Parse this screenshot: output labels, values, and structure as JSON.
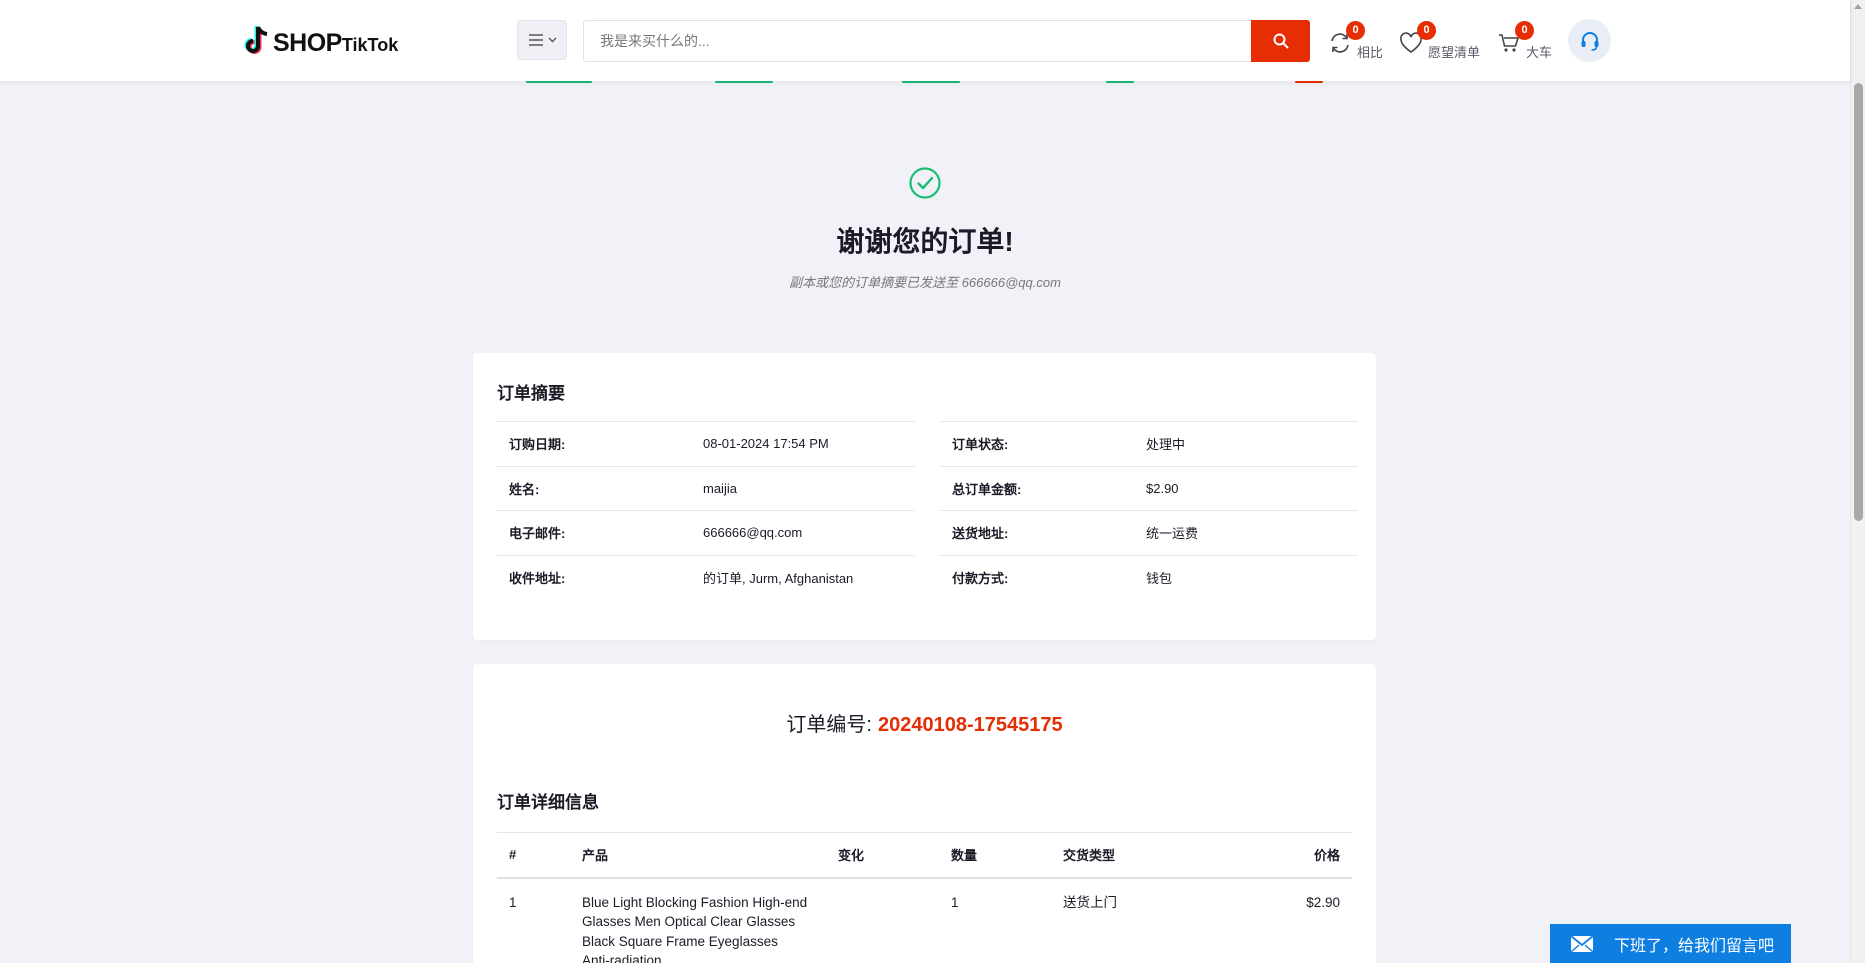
{
  "header": {
    "logo": {
      "shop": "SHOP",
      "tiktok": "TikTok"
    },
    "search": {
      "placeholder": "我是来买什么的..."
    },
    "compare": {
      "label": "相比",
      "count": "0"
    },
    "wishlist": {
      "label": "愿望清单",
      "count": "0"
    },
    "cart": {
      "label": "大车",
      "count": "0"
    },
    "icons": [
      "menu-icon",
      "chevron-down-icon",
      "search-icon",
      "refresh-icon",
      "heart-icon",
      "cart-icon",
      "headset-icon"
    ]
  },
  "colors": {
    "accent": "#e62d04",
    "success": "#1abc74",
    "chat": "#0e7fe1"
  },
  "hero": {
    "title": "谢谢您的订单!",
    "subtitle": "副本或您的订单摘要已发送至 666666@qq.com"
  },
  "summary": {
    "title": "订单摘要",
    "left": [
      {
        "k": "订购日期:",
        "v": "08-01-2024 17:54 PM"
      },
      {
        "k": "姓名:",
        "v": "maijia"
      },
      {
        "k": "电子邮件:",
        "v": "666666@qq.com"
      },
      {
        "k": "收件地址:",
        "v": "的订单, Jurm, Afghanistan"
      }
    ],
    "right": [
      {
        "k": "订单状态:",
        "v": "处理中"
      },
      {
        "k": "总订单金额:",
        "v": "$2.90"
      },
      {
        "k": "送货地址:",
        "v": "统一运费"
      },
      {
        "k": "付款方式:",
        "v": "钱包"
      }
    ]
  },
  "order": {
    "code_label": "订单编号:",
    "code": "20240108-17545175",
    "details_title": "订单详细信息",
    "columns": [
      "#",
      "产品",
      "变化",
      "数量",
      "交货类型",
      "价格"
    ],
    "rows": [
      {
        "index": "1",
        "product": "Blue Light Blocking Fashion High-end Glasses Men Optical Clear Glasses Black Square Frame Eyeglasses Anti-radiation",
        "variation": "",
        "qty": "1",
        "delivery": "送货上门",
        "price": "$2.90"
      }
    ]
  },
  "chat": {
    "label": "下班了，给我们留言吧",
    "icon": "mail-icon"
  }
}
